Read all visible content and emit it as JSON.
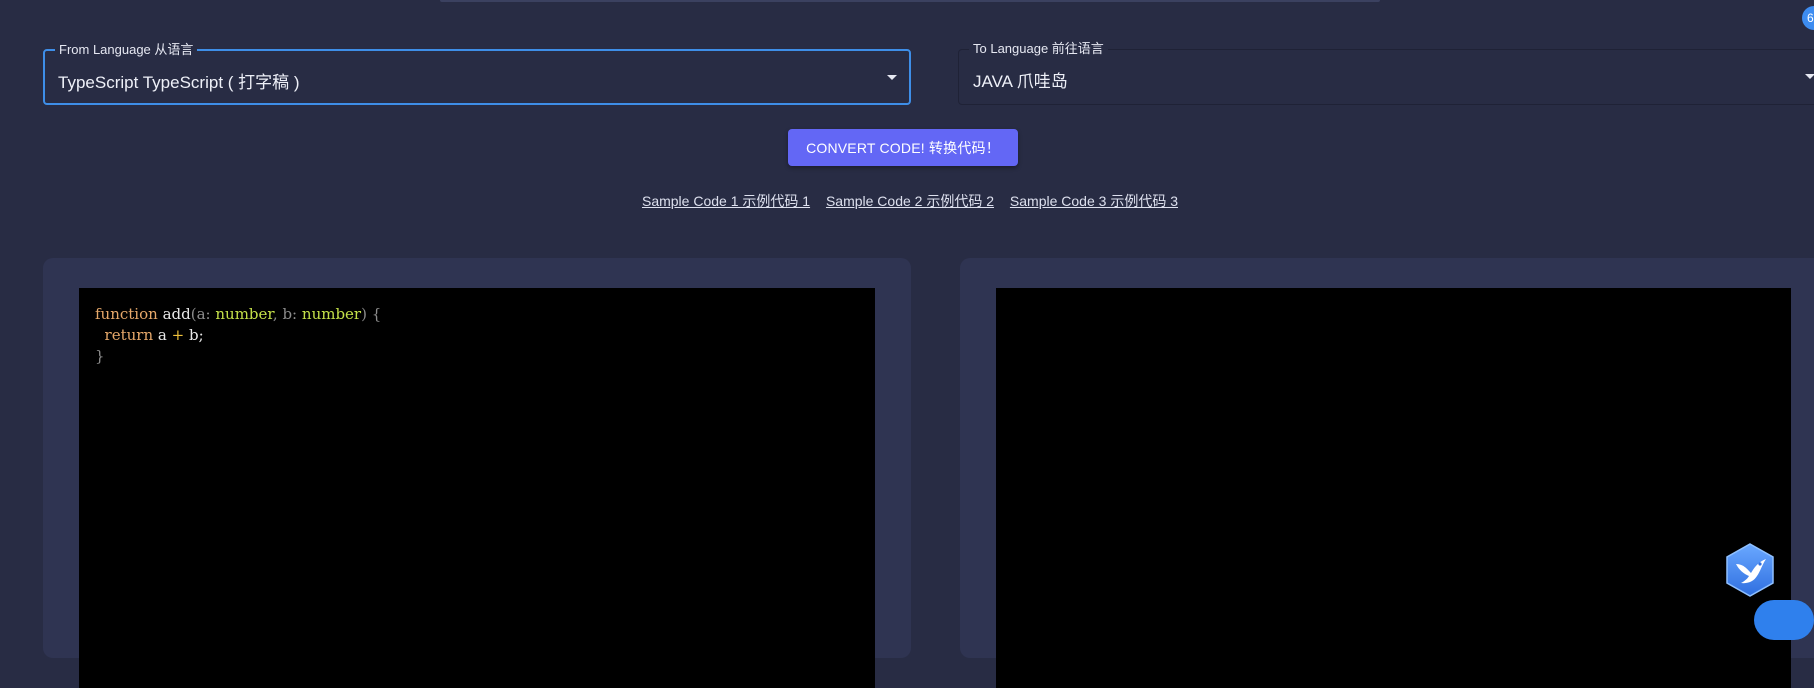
{
  "notification": {
    "badge_text": "6"
  },
  "from_select": {
    "label": "From Language 从语言",
    "value": "TypeScript TypeScript ( 打字稿 )"
  },
  "to_select": {
    "label": "To Language 前往语言",
    "value": "JAVA 爪哇岛"
  },
  "convert_button": {
    "label": "CONVERT CODE! 转换代码！"
  },
  "sample_links": [
    "Sample Code 1 示例代码 1",
    "Sample Code 2 示例代码 2",
    "Sample Code 3 示例代码 3"
  ],
  "source_code": {
    "line1": {
      "keyword": "function",
      "name": "add",
      "p1_open": "(a:",
      "type1": "number",
      "p1_sep": ", b:",
      "type2": "number",
      "p1_close": ") {"
    },
    "line2": {
      "keyword": "return",
      "left": "a",
      "operator": "+",
      "right": "b;"
    },
    "line3": {
      "close": "}"
    }
  },
  "colors": {
    "background": "#282c44",
    "panel": "#2f3452",
    "accent": "#6367f5",
    "focus_border": "#3e8ee8",
    "editor": "#000000"
  },
  "icons": {
    "dropdown": "chevron-down-icon",
    "assistant": "bird-logo-icon"
  }
}
